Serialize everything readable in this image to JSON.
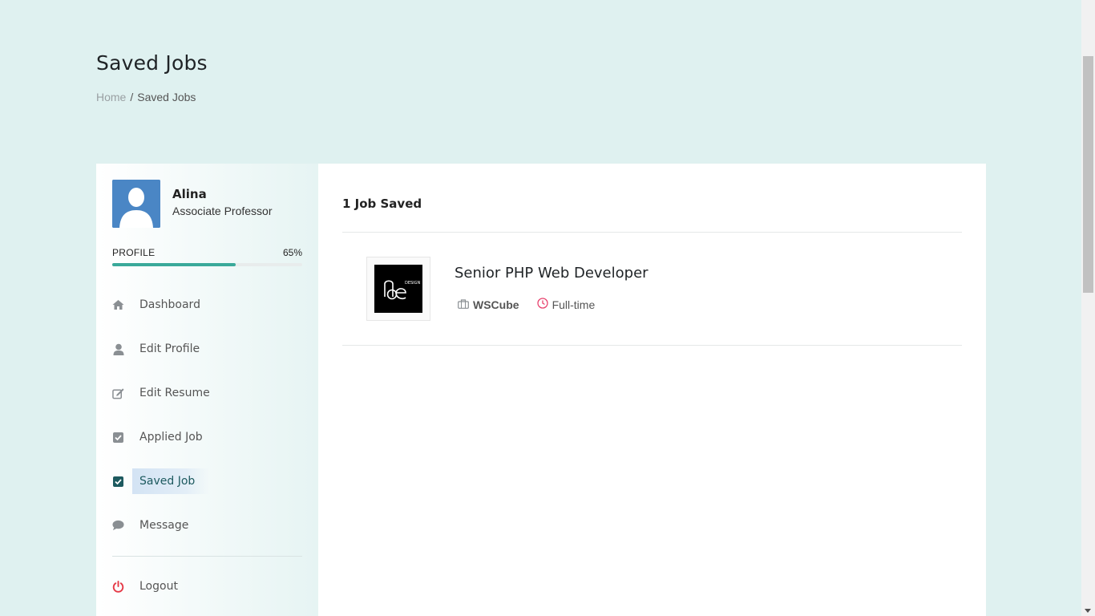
{
  "header": {
    "title": "Saved Jobs",
    "breadcrumb": {
      "home": "Home",
      "separator": "/",
      "current": "Saved Jobs"
    }
  },
  "profile": {
    "name": "Alina",
    "role": "Associate Professor",
    "progress_label": "PROFILE",
    "progress_text": "65%",
    "progress_value": 0.65
  },
  "sidebar": {
    "items": [
      {
        "label": "Dashboard",
        "icon": "home-icon",
        "active": false
      },
      {
        "label": "Edit Profile",
        "icon": "user-icon",
        "active": false
      },
      {
        "label": "Edit Resume",
        "icon": "edit-icon",
        "active": false
      },
      {
        "label": "Applied Job",
        "icon": "checkbox-icon",
        "active": false
      },
      {
        "label": "Saved Job",
        "icon": "checkbox-checked-icon",
        "active": true
      },
      {
        "label": "Message",
        "icon": "chat-bubble-icon",
        "active": false
      }
    ],
    "logout": {
      "label": "Logout",
      "icon": "power-icon"
    }
  },
  "main": {
    "count_text": "1 Job Saved",
    "jobs": [
      {
        "title": "Senior PHP Web Developer",
        "company": "WSCube",
        "type": "Full-time",
        "company_icon": "briefcase-icon",
        "type_icon": "clock-icon",
        "logo_text": "DESIGN"
      }
    ]
  },
  "colors": {
    "page_bg": "#dff1f0",
    "accent": "#3aa99a",
    "logout_red": "#e53946",
    "active_check": "#1d5a5f",
    "clock_pink": "#e8416d"
  }
}
